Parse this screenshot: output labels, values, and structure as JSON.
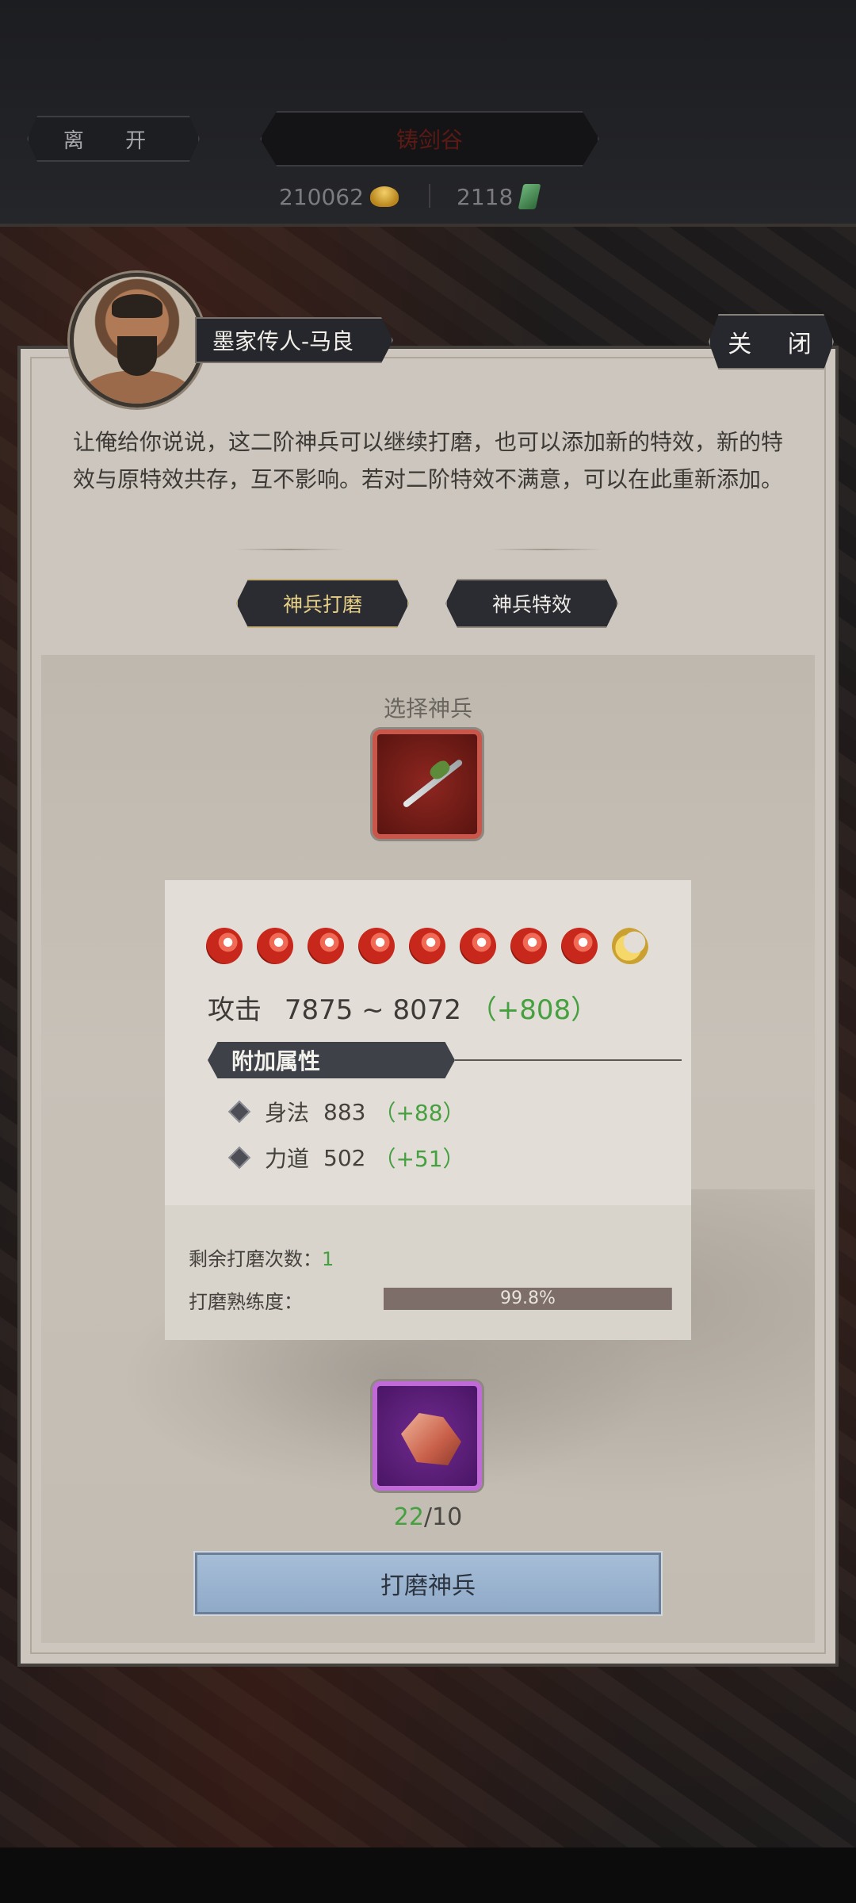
{
  "header": {
    "leave_label": "离 开",
    "title": "铸剑谷",
    "gold_amount": "210062",
    "jade_amount": "2118",
    "gold_icon": "gold-ingot-icon",
    "jade_icon": "jade-token-icon"
  },
  "npc": {
    "name": "墨家传人-马良",
    "dialogue": "让俺给你说说，这二阶神兵可以继续打磨，也可以添加新的特效，新的特效与原特效共存，互不影响。若对二阶特效不满意，可以在此重新添加。"
  },
  "close_label": "关 闭",
  "tabs": [
    {
      "label": "神兵打磨",
      "active": true
    },
    {
      "label": "神兵特效",
      "active": false
    }
  ],
  "select_label": "选择神兵",
  "weapon": {
    "icon": "spear-icon",
    "orbs_full": 8,
    "orbs_half": 1,
    "attack_label": "攻击",
    "attack_value": "7875 ~ 8072",
    "attack_bonus": "（+808）",
    "attr_header": "附加属性",
    "attrs": [
      {
        "name": "身法",
        "value": "883",
        "bonus": "（+88）"
      },
      {
        "name": "力道",
        "value": "502",
        "bonus": "（+51）"
      }
    ],
    "remaining_label": "剩余打磨次数：",
    "remaining_value": "1",
    "proficiency_label": "打磨熟练度：",
    "proficiency_text": "99.8%",
    "proficiency_fraction": 0.998
  },
  "material": {
    "icon": "ore-icon",
    "have": "22",
    "need": "/10"
  },
  "grind_button_label": "打磨神兵",
  "colors": {
    "bonus_green": "#45a040",
    "active_tab_text": "#e7cf88",
    "button_blue": "#a6bdd7"
  }
}
